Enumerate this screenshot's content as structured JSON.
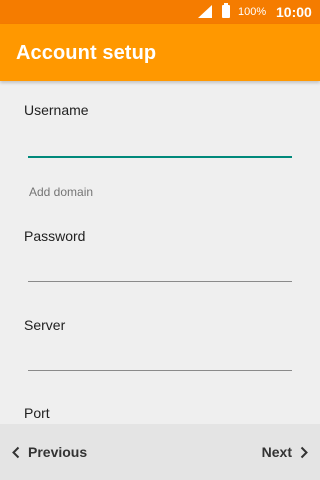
{
  "status_bar": {
    "battery_percent": "100%",
    "time": "10:00"
  },
  "app_bar": {
    "title": "Account setup"
  },
  "form": {
    "username": {
      "label": "Username",
      "value": ""
    },
    "add_domain": "Add domain",
    "password": {
      "label": "Password",
      "value": ""
    },
    "server": {
      "label": "Server",
      "value": ""
    },
    "port": {
      "label": "Port"
    }
  },
  "navigation": {
    "previous_label": "Previous",
    "next_label": "Next"
  },
  "colors": {
    "status_bar": "#f57c00",
    "app_bar": "#ff9800",
    "focus_underline": "#00897b"
  }
}
